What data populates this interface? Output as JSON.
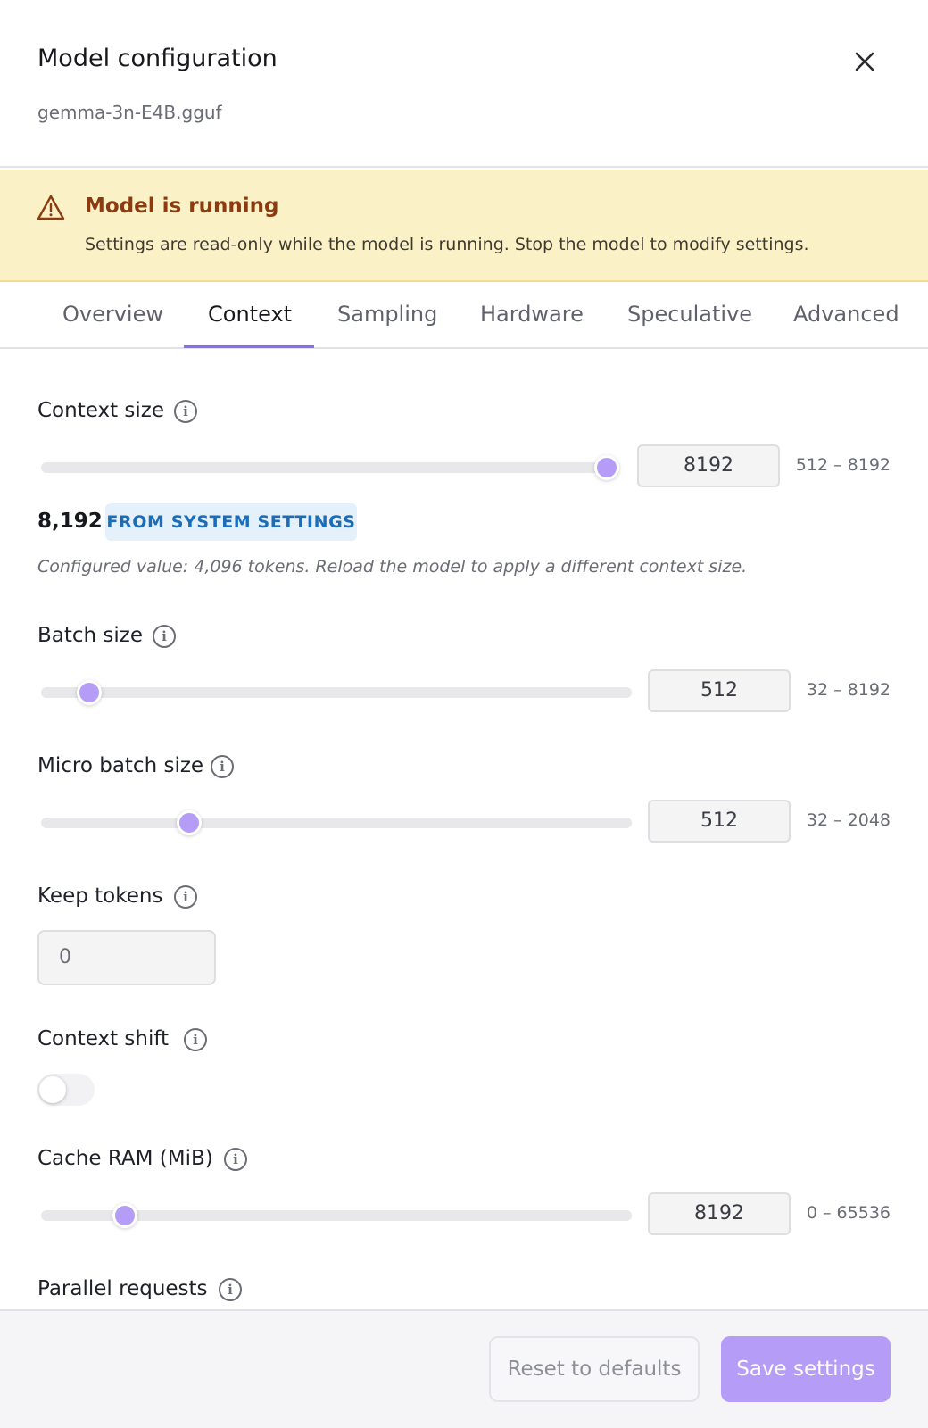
{
  "dialog": {
    "title": "Model configuration",
    "model_file": "gemma-3n-E4B.gguf"
  },
  "warning": {
    "title": "Model is running",
    "message": "Settings are read-only while the model is running. Stop the model to modify settings."
  },
  "tabs": [
    {
      "label": "Overview",
      "active": false
    },
    {
      "label": "Context",
      "active": true
    },
    {
      "label": "Sampling",
      "active": false
    },
    {
      "label": "Hardware",
      "active": false
    },
    {
      "label": "Speculative",
      "active": false
    },
    {
      "label": "Advanced",
      "active": false
    }
  ],
  "settings": {
    "context_size": {
      "label": "Context size",
      "value": "8192",
      "min": 512,
      "max": 8192,
      "range": "512 – 8192",
      "display_value": "8,192",
      "badge": "FROM SYSTEM SETTINGS",
      "note": "Configured value: 4,096 tokens. Reload the model to apply a different context size."
    },
    "batch_size": {
      "label": "Batch size",
      "value": "512",
      "min": 32,
      "max": 8192,
      "range": "32 – 8192"
    },
    "micro_batch_size": {
      "label": "Micro batch size",
      "value": "512",
      "min": 32,
      "max": 2048,
      "range": "32 – 2048"
    },
    "keep_tokens": {
      "label": "Keep tokens",
      "value": "0"
    },
    "context_shift": {
      "label": "Context shift",
      "enabled": false
    },
    "cache_ram": {
      "label": "Cache RAM (MiB)",
      "value": "8192",
      "min": 0,
      "max": 65536,
      "range": "0 – 65536"
    },
    "parallel_requests": {
      "label": "Parallel requests"
    }
  },
  "footer": {
    "reset_label": "Reset to defaults",
    "save_label": "Save settings"
  },
  "colors": {
    "accent": "#8b6cf0",
    "slider_thumb": "#b49cf7",
    "warning_bg": "#fbf1c6",
    "warning_title": "#8c3b10",
    "badge_bg": "#e4f1fb",
    "badge_text": "#1c6db8"
  },
  "icons": {
    "close": "close-icon",
    "warning": "warning-triangle-icon",
    "info": "info-icon"
  }
}
